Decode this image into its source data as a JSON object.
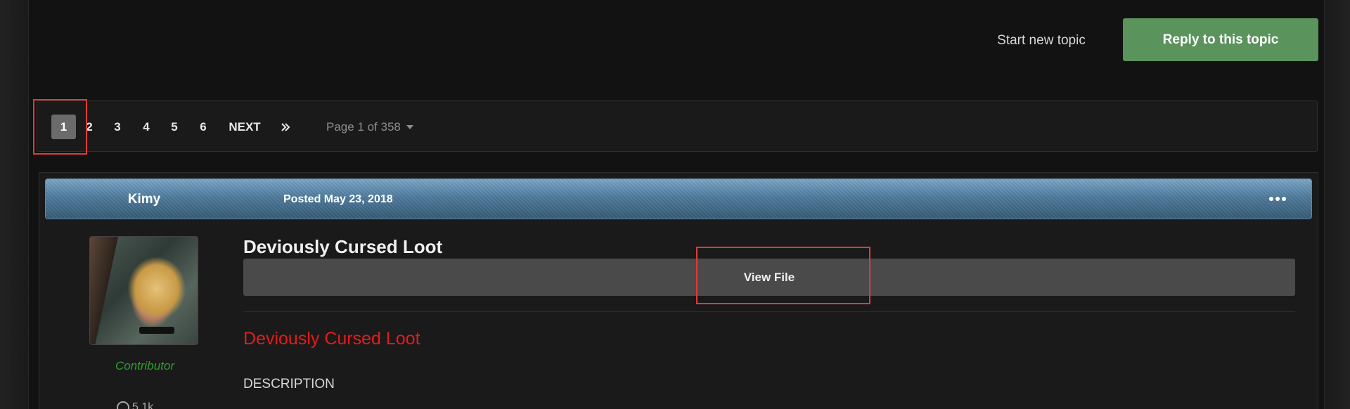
{
  "actions": {
    "start_new_topic": "Start new topic",
    "reply": "Reply to this topic"
  },
  "pagination": {
    "pages": [
      "1",
      "2",
      "3",
      "4",
      "5",
      "6"
    ],
    "active_page": "1",
    "next_label": "NEXT",
    "last_icon": "double-chevron-right-icon",
    "page_status": "Page 1 of 358"
  },
  "post": {
    "author": "Kimy",
    "posted": "Posted May 23, 2018",
    "more_icon": "ellipsis-icon",
    "author_role": "Contributor",
    "author_stat": "5.1k",
    "title": "Deviously Cursed Loot",
    "view_file_label": "View File",
    "file_link": "Deviously Cursed Loot",
    "description_heading": "DESCRIPTION"
  },
  "colors": {
    "reply_button": "#5a935c",
    "header_blue": "#4e7a9c",
    "role_green": "#2fa02f",
    "file_link_red": "#e51b1b",
    "highlight": "#e03a3a"
  }
}
